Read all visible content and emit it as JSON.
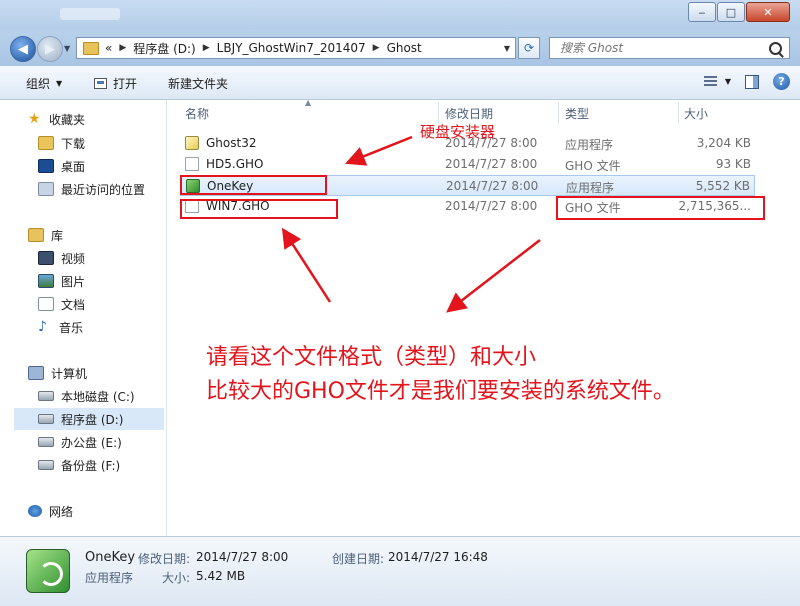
{
  "window": {
    "controls": {
      "minimize": "‒",
      "maximize": "□",
      "close": "✕"
    }
  },
  "address": {
    "overflow": "«",
    "crumbs": [
      "程序盘 (D:)",
      "LBJY_GhostWin7_201407",
      "Ghost"
    ],
    "search_placeholder": "搜索 Ghost"
  },
  "toolbar": {
    "organize": "组织",
    "open": "打开",
    "new_folder": "新建文件夹"
  },
  "nav": {
    "favorites": "收藏夹",
    "downloads": "下载",
    "desktop": "桌面",
    "recent": "最近访问的位置",
    "libraries": "库",
    "videos": "视频",
    "pictures": "图片",
    "documents": "文档",
    "music": "音乐",
    "computer": "计算机",
    "local_c": "本地磁盘 (C:)",
    "program_d": "程序盘 (D:)",
    "office_e": "办公盘 (E:)",
    "backup_f": "备份盘 (F:)",
    "network": "网络"
  },
  "columns": {
    "name": "名称",
    "date": "修改日期",
    "type": "类型",
    "size": "大小"
  },
  "files": [
    {
      "name": "Ghost32",
      "date": "2014/7/27 8:00",
      "type": "应用程序",
      "size": "3,204 KB",
      "icon": "ghost-exe-icon"
    },
    {
      "name": "HD5.GHO",
      "date": "2014/7/27 8:00",
      "type": "GHO 文件",
      "size": "93 KB",
      "icon": "file-icon"
    },
    {
      "name": "OneKey",
      "date": "2014/7/27 8:00",
      "type": "应用程序",
      "size": "5,552 KB",
      "icon": "onekey-icon"
    },
    {
      "name": "WIN7.GHO",
      "date": "2014/7/27 8:00",
      "type": "GHO 文件",
      "size": "2,715,365...",
      "icon": "file-icon"
    }
  ],
  "annotations": {
    "installer_label": "硬盘安装器",
    "line1": "请看这个文件格式（类型）和大小",
    "line2": "比较大的GHO文件才是我们要安装的系统文件。",
    "color": "#e3141b"
  },
  "details": {
    "name": "OneKey",
    "type": "应用程序",
    "modified_label": "修改日期:",
    "modified_value": "2014/7/27 8:00",
    "created_label": "创建日期:",
    "created_value": "2014/7/27 16:48",
    "size_label": "大小:",
    "size_value": "5.42 MB"
  }
}
